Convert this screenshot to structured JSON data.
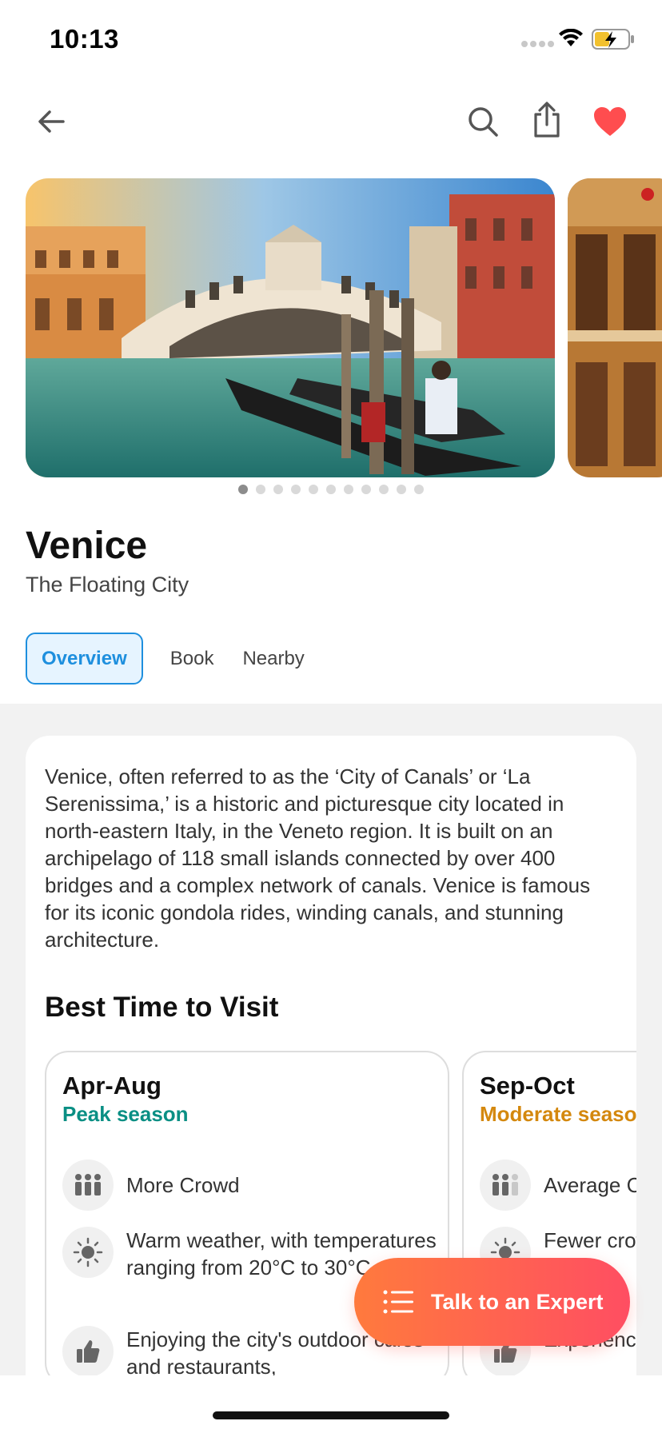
{
  "status_bar": {
    "time": "10:13"
  },
  "destination": {
    "title": "Venice",
    "subtitle": "The Floating City"
  },
  "carousel": {
    "total_slides": 11,
    "active_index": 0
  },
  "tabs": [
    {
      "label": "Overview",
      "active": true
    },
    {
      "label": "Book",
      "active": false
    },
    {
      "label": "Nearby",
      "active": false
    }
  ],
  "overview": {
    "description": "Venice, often referred to as the ‘City of Canals’ or ‘La Serenissima,’ is a historic and picturesque city located in north-eastern Italy, in the Veneto region. It is built on an archipelago of 118 small islands connected by over 400 bridges and a complex network of canals. Venice is famous for its iconic gondola rides, winding canals, and stunning architecture.",
    "best_time_title": "Best Time to Visit",
    "seasons": [
      {
        "months": "Apr-Aug",
        "label": "Peak season",
        "label_color": "#0a8f84",
        "features": [
          {
            "icon": "crowd-icon",
            "text": "More Crowd"
          },
          {
            "icon": "sun-icon",
            "text": "Warm weather, with temperatures ranging from 20°C to 30°C"
          },
          {
            "icon": "thumbs-up-icon",
            "text": "Enjoying the city's outdoor cafes and restaurants,"
          }
        ]
      },
      {
        "months": "Sep-Oct",
        "label": "Moderate season",
        "label_color": "#d4880e",
        "features": [
          {
            "icon": "crowd-icon",
            "text": "Average Crowd"
          },
          {
            "icon": "sun-icon",
            "text": "Fewer crowds and pleasant"
          },
          {
            "icon": "thumbs-up-icon",
            "text": "Experience during spring"
          }
        ]
      }
    ]
  },
  "cta": {
    "label": "Talk to an Expert"
  },
  "colors": {
    "accent_blue": "#1e8fde",
    "favorite_red": "#ff4d4f",
    "cta_gradient_start": "#ff7a3d",
    "cta_gradient_end": "#ff4e62"
  }
}
